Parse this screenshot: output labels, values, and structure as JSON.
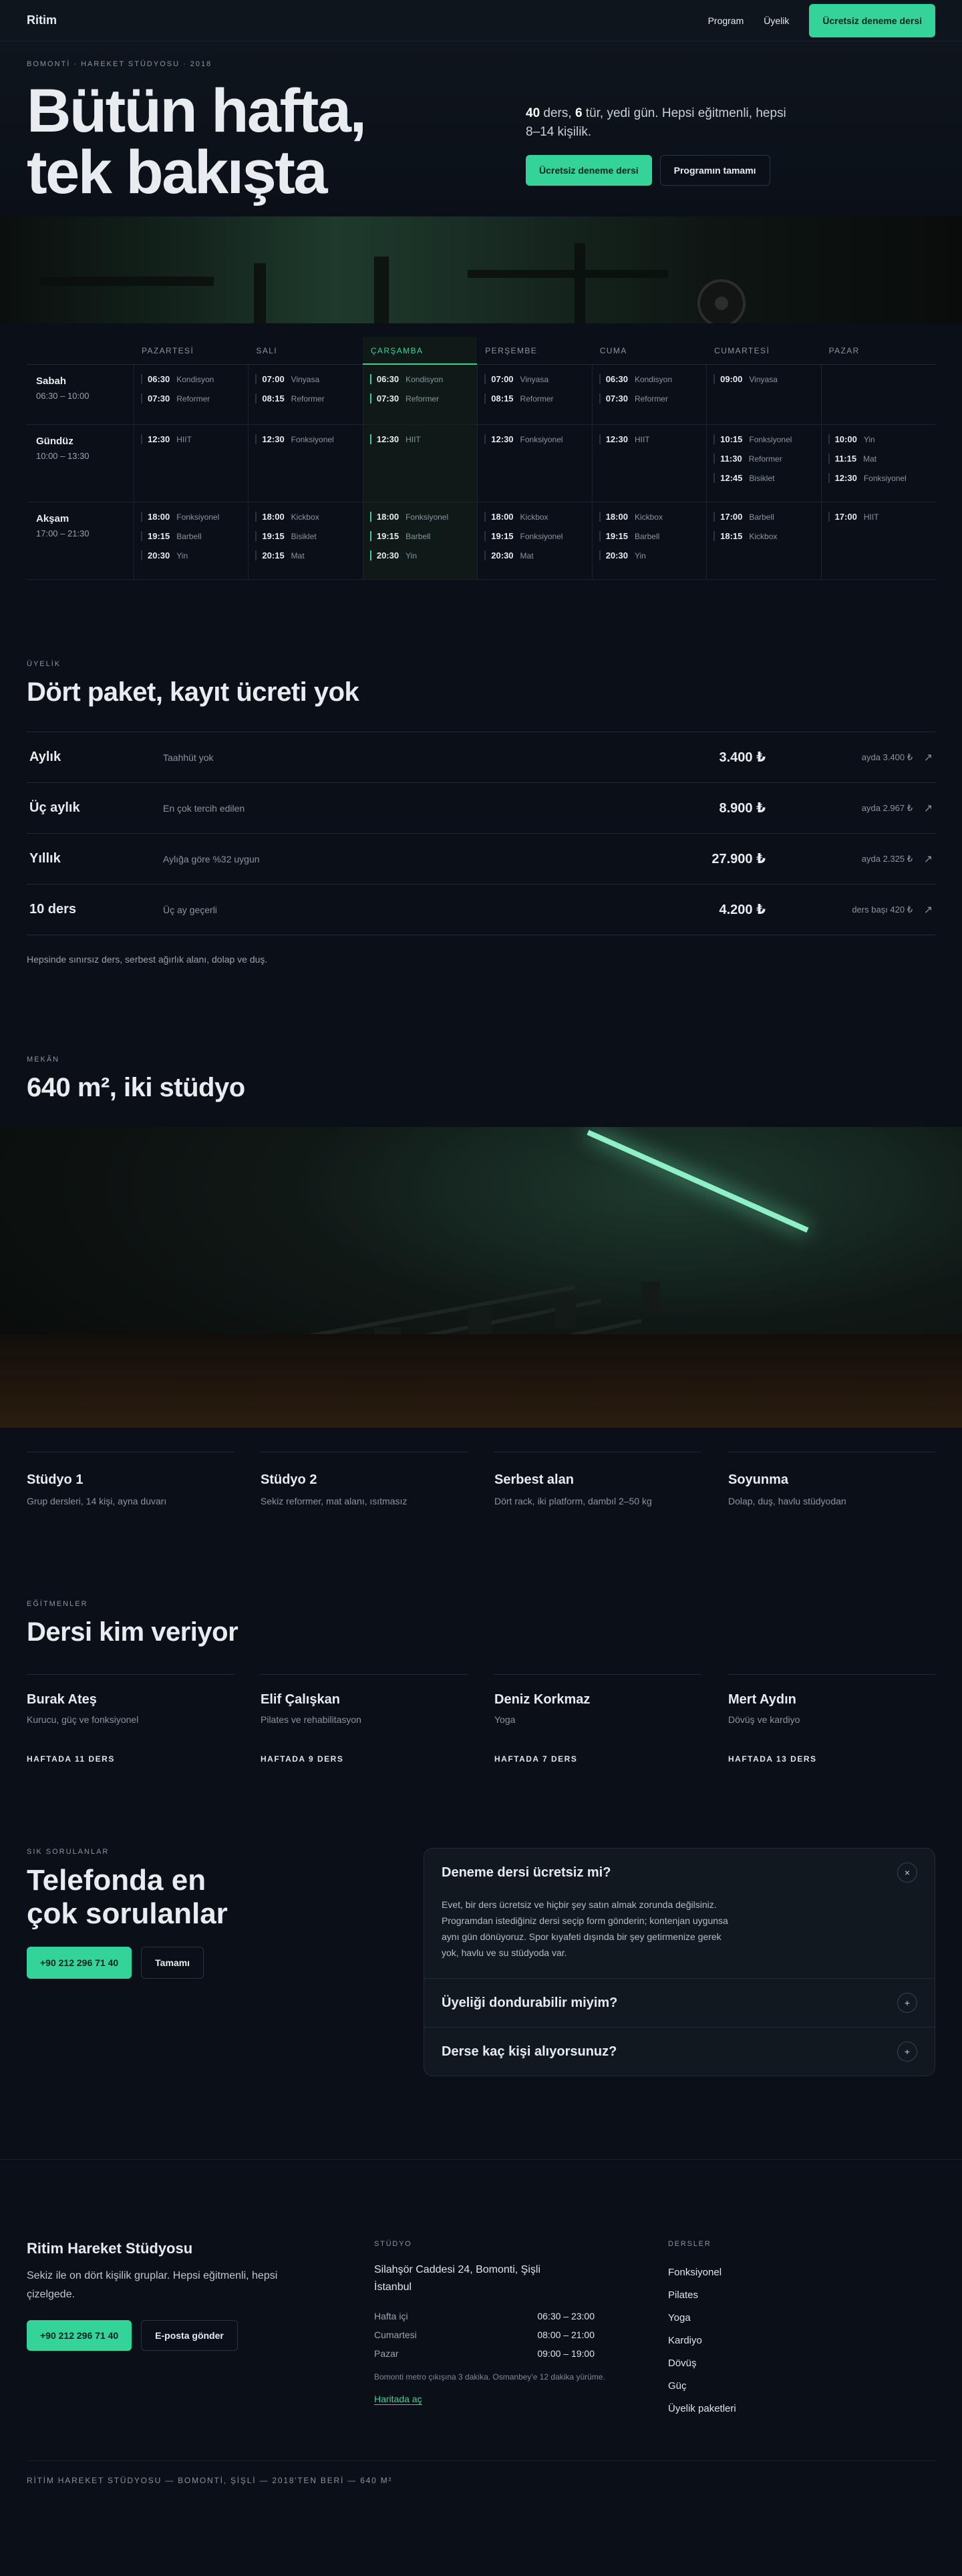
{
  "nav": {
    "logo": "Ritim",
    "links": [
      "Program",
      "Üyelik"
    ],
    "cta": "Ücretsiz deneme dersi"
  },
  "hero": {
    "eyebrow": "BOMONTİ · HAREKET STÜDYOSU · 2018",
    "title_line1": "Bütün hafta,",
    "title_line2": "tek bakışta",
    "desc_n1": "40",
    "desc_t1": " ders, ",
    "desc_n2": "6",
    "desc_t2": " tür, yedi gün. Hepsi eğitmenli, hepsi 8–14 kişilik.",
    "btn_primary": "Ücretsiz deneme dersi",
    "btn_secondary": "Programın tamamı"
  },
  "schedule": {
    "days": [
      "PAZARTESİ",
      "SALI",
      "ÇARŞAMBA",
      "PERŞEMBE",
      "CUMA",
      "CUMARTESİ",
      "PAZAR"
    ],
    "rows": [
      {
        "name": "Sabah",
        "time": "06:30 – 10:00",
        "cells": [
          [
            [
              "06:30",
              "Kondisyon"
            ],
            [
              "07:30",
              "Reformer"
            ]
          ],
          [
            [
              "07:00",
              "Vinyasa"
            ],
            [
              "08:15",
              "Reformer"
            ]
          ],
          [
            [
              "06:30",
              "Kondisyon"
            ],
            [
              "07:30",
              "Reformer"
            ]
          ],
          [
            [
              "07:00",
              "Vinyasa"
            ],
            [
              "08:15",
              "Reformer"
            ]
          ],
          [
            [
              "06:30",
              "Kondisyon"
            ],
            [
              "07:30",
              "Reformer"
            ]
          ],
          [
            [
              "09:00",
              "Vinyasa"
            ]
          ],
          []
        ]
      },
      {
        "name": "Gündüz",
        "time": "10:00 – 13:30",
        "cells": [
          [
            [
              "12:30",
              "HIIT"
            ]
          ],
          [
            [
              "12:30",
              "Fonksiyonel"
            ]
          ],
          [
            [
              "12:30",
              "HIIT"
            ]
          ],
          [
            [
              "12:30",
              "Fonksiyonel"
            ]
          ],
          [
            [
              "12:30",
              "HIIT"
            ]
          ],
          [
            [
              "10:15",
              "Fonksiyonel"
            ],
            [
              "11:30",
              "Reformer"
            ],
            [
              "12:45",
              "Bisiklet"
            ]
          ],
          [
            [
              "10:00",
              "Yin"
            ],
            [
              "11:15",
              "Mat"
            ],
            [
              "12:30",
              "Fonksiyonel"
            ]
          ]
        ]
      },
      {
        "name": "Akşam",
        "time": "17:00 – 21:30",
        "cells": [
          [
            [
              "18:00",
              "Fonksiyonel"
            ],
            [
              "19:15",
              "Barbell"
            ],
            [
              "20:30",
              "Yin"
            ]
          ],
          [
            [
              "18:00",
              "Kickbox"
            ],
            [
              "19:15",
              "Bisiklet"
            ],
            [
              "20:15",
              "Mat"
            ]
          ],
          [
            [
              "18:00",
              "Fonksiyonel"
            ],
            [
              "19:15",
              "Barbell"
            ],
            [
              "20:30",
              "Yin"
            ]
          ],
          [
            [
              "18:00",
              "Kickbox"
            ],
            [
              "19:15",
              "Fonksiyonel"
            ],
            [
              "20:30",
              "Mat"
            ]
          ],
          [
            [
              "18:00",
              "Kickbox"
            ],
            [
              "19:15",
              "Barbell"
            ],
            [
              "20:30",
              "Yin"
            ]
          ],
          [
            [
              "17:00",
              "Barbell"
            ],
            [
              "18:15",
              "Kickbox"
            ]
          ],
          [
            [
              "17:00",
              "HIIT"
            ]
          ]
        ]
      }
    ]
  },
  "membership": {
    "eyebrow": "ÜYELİK",
    "title": "Dört paket, kayıt ücreti yok",
    "note": "Hepsinde sınırsız ders, serbest ağırlık alanı, dolap ve duş.",
    "arrow": "↗",
    "plans": [
      {
        "name": "Aylık",
        "desc": "Taahhüt yok",
        "price": "3.400 ₺",
        "monthly": "ayda 3.400 ₺"
      },
      {
        "name": "Üç aylık",
        "desc": "En çok tercih edilen",
        "price": "8.900 ₺",
        "monthly": "ayda 2.967 ₺"
      },
      {
        "name": "Yıllık",
        "desc": "Aylığa göre %32 uygun",
        "price": "27.900 ₺",
        "monthly": "ayda 2.325 ₺"
      },
      {
        "name": "10 ders",
        "desc": "Üç ay geçerli",
        "price": "4.200 ₺",
        "monthly": "ders başı 420 ₺"
      }
    ]
  },
  "space": {
    "eyebrow": "MEKÂN",
    "title": "640 m², iki stüdyo",
    "rooms": [
      {
        "name": "Stüdyo 1",
        "desc": "Grup dersleri, 14 kişi, ayna duvarı"
      },
      {
        "name": "Stüdyo 2",
        "desc": "Sekiz reformer, mat alanı, ısıtmasız"
      },
      {
        "name": "Serbest alan",
        "desc": "Dört rack, iki platform, dambıl 2–50 kg"
      },
      {
        "name": "Soyunma",
        "desc": "Dolap, duş, havlu stüdyodan"
      }
    ]
  },
  "trainers": {
    "eyebrow": "EĞİTMENLER",
    "title": "Dersi kim veriyor",
    "items": [
      {
        "name": "Burak Ateş",
        "role": "Kurucu, güç ve fonksiyonel",
        "count": "HAFTADA 11 DERS"
      },
      {
        "name": "Elif Çalışkan",
        "role": "Pilates ve rehabilitasyon",
        "count": "HAFTADA 9 DERS"
      },
      {
        "name": "Deniz Korkmaz",
        "role": "Yoga",
        "count": "HAFTADA 7 DERS"
      },
      {
        "name": "Mert Aydın",
        "role": "Dövüş ve kardiyo",
        "count": "HAFTADA 13 DERS"
      }
    ]
  },
  "faq": {
    "eyebrow": "SIK SORULANLAR",
    "title_line1": "Telefonda en",
    "title_line2": "çok sorulanlar",
    "phone": "+90 212 296 71 40",
    "all": "Tamamı",
    "items": [
      {
        "q": "Deneme dersi ücretsiz mi?",
        "a": "Evet, bir ders ücretsiz ve hiçbir şey satın almak zorunda değilsiniz. Programdan istediğiniz dersi seçip form gönderin; kontenjan uygunsa aynı gün dönüyoruz. Spor kıyafeti dışında bir şey getirmenize gerek yok, havlu ve su stüdyoda var.",
        "icon": "×"
      },
      {
        "q": "Üyeliği dondurabilir miyim?",
        "icon": "+"
      },
      {
        "q": "Derse kaç kişi alıyorsunuz?",
        "icon": "+"
      }
    ]
  },
  "footer": {
    "name": "Ritim Hareket Stüdyosu",
    "desc": "Sekiz ile on dört kişilik gruplar. Hepsi eğitmenli, hepsi çizelgede.",
    "phone": "+90 212 296 71 40",
    "email": "E-posta gönder",
    "studio_title": "STÜDYO",
    "address": "Silahşör Caddesi 24, Bomonti, Şişli İstanbul",
    "hours": [
      [
        "Hafta içi",
        "06:30 – 23:00"
      ],
      [
        "Cumartesi",
        "08:00 – 21:00"
      ],
      [
        "Pazar",
        "09:00 – 19:00"
      ]
    ],
    "note": "Bomonti metro çıkışına 3 dakika. Osmanbey'e 12 dakika yürüme.",
    "map": "Haritada aç",
    "lessons_title": "DERSLER",
    "lessons": [
      "Fonksiyonel",
      "Pilates",
      "Yoga",
      "Kardiyo",
      "Dövüş",
      "Güç",
      "Üyelik paketleri"
    ],
    "bottom": "RİTİM HAREKET STÜDYOSU — BOMONTİ, ŞİŞLİ — 2018'TEN BERİ — 640 M²"
  },
  "colors": {
    "accent": "#34d399",
    "bg": "#0b1018"
  }
}
